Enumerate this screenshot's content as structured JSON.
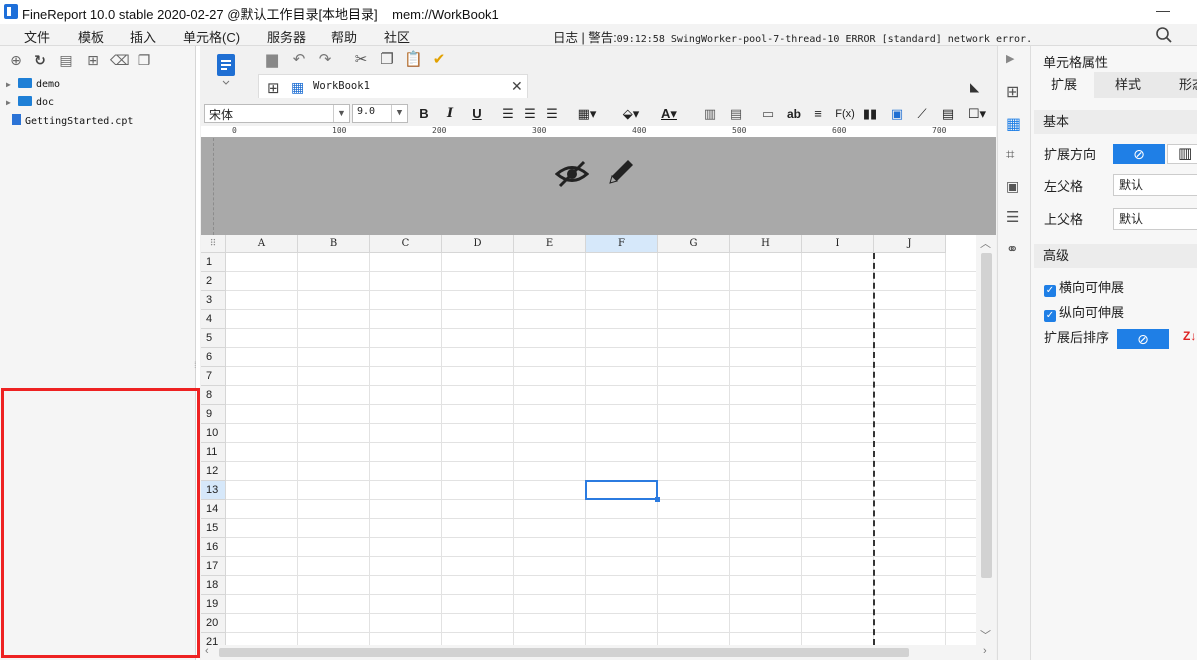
{
  "window": {
    "title": "FineReport 10.0 stable 2020-02-27 @默认工作目录[本地目录]    mem://WorkBook1",
    "minimize_glyph": "—"
  },
  "menubar": {
    "items": [
      "文件",
      "模板",
      "插入",
      "单元格(C)",
      "服务器",
      "帮助",
      "社区"
    ],
    "log_label": "日志 | 警告:",
    "log_text": "09:12:58 SwingWorker-pool-7-thread-10 ERROR [standard] network error."
  },
  "filetree": {
    "items": [
      {
        "label": "demo",
        "type": "folder"
      },
      {
        "label": "doc",
        "type": "folder"
      },
      {
        "label": "GettingStarted.cpt",
        "type": "file"
      }
    ]
  },
  "editor": {
    "tab_label": "WorkBook1",
    "font_name": "宋体",
    "font_size": "9.0"
  },
  "ruler": {
    "marks": [
      "0",
      "100",
      "200",
      "300",
      "400",
      "500",
      "600",
      "700"
    ]
  },
  "sheet": {
    "columns": [
      "A",
      "B",
      "C",
      "D",
      "E",
      "F",
      "G",
      "H",
      "I",
      "J"
    ],
    "rows": [
      "1",
      "2",
      "3",
      "4",
      "5",
      "6",
      "7",
      "8",
      "9",
      "10",
      "11",
      "12",
      "13",
      "14",
      "15",
      "16",
      "17",
      "18",
      "19",
      "20",
      "21"
    ],
    "selected_cell": "F13"
  },
  "props": {
    "title": "单元格属性",
    "tabs": [
      "扩展",
      "样式",
      "形态"
    ],
    "basic_header": "基本",
    "expand_dir_label": "扩展方向",
    "left_parent_label": "左父格",
    "left_parent_value": "默认",
    "top_parent_label": "上父格",
    "top_parent_value": "默认",
    "advanced_header": "高级",
    "h_expandable": "横向可伸展",
    "v_expandable": "纵向可伸展",
    "sort_label": "扩展后排序"
  },
  "colors": {
    "accent": "#1f7fe6",
    "highlight_box": "#e22222"
  }
}
